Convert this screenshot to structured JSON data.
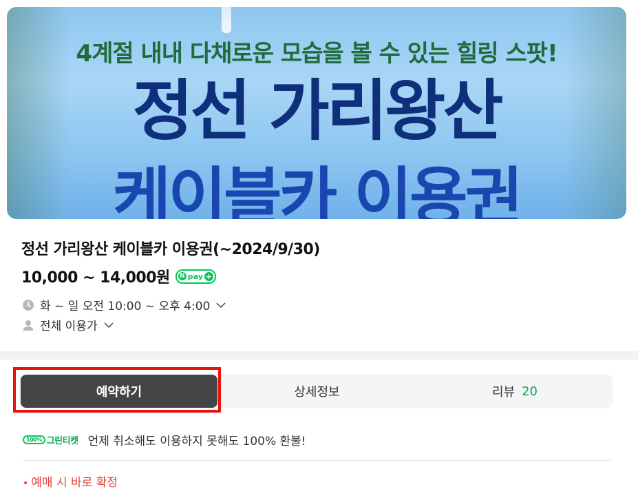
{
  "banner": {
    "subtitle": "4계절 내내 다채로운 모습을 볼 수 있는 힐링 스팟!",
    "title_line1": "정선 가리왕산",
    "title_line2": "케이블카 이용권"
  },
  "product": {
    "title": "정선 가리왕산 케이블카 이용권(~2024/9/30)",
    "price": "10,000 ~ 14,000원",
    "npay_label": "pay",
    "hours": "화 ~ 일 오전 10:00 ~ 오후 4:00",
    "age": "전체 이용가"
  },
  "tabs": {
    "reserve": "예약하기",
    "detail": "상세정보",
    "review": "리뷰",
    "review_count": "20"
  },
  "green_ticket": {
    "logo_badge": "100%",
    "logo_text": "그린티켓",
    "text": "언제 취소해도 이용하지 못해도 100% 환불!"
  },
  "notice": {
    "text": "예매 시 바로 확정"
  },
  "colors": {
    "accent_green": "#03c75a",
    "active_tab": "#444446",
    "highlight": "#e8120c",
    "notice": "#e8413a"
  }
}
